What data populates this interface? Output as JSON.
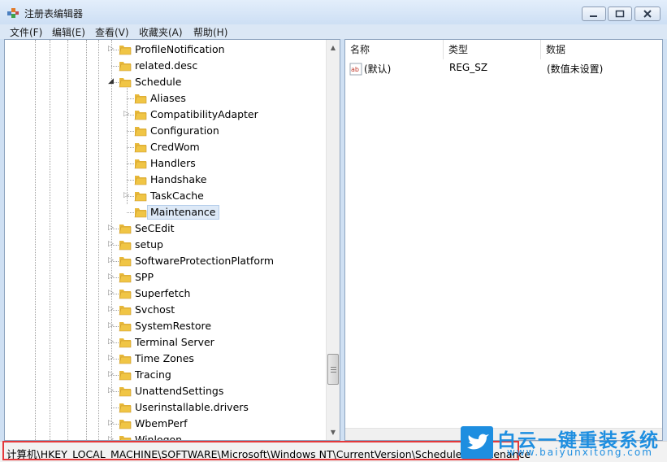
{
  "window": {
    "title": "注册表编辑器"
  },
  "menu": [
    "文件(F)",
    "编辑(E)",
    "查看(V)",
    "收藏夹(A)",
    "帮助(H)"
  ],
  "tree": {
    "nodes": [
      {
        "label": "ProfileNotification",
        "expandable": true,
        "selected": false
      },
      {
        "label": "related.desc",
        "expandable": false,
        "selected": false
      },
      {
        "label": "Schedule",
        "expandable": true,
        "expanded": true,
        "selected": false
      },
      {
        "label": "Aliases",
        "expandable": false,
        "selected": false
      },
      {
        "label": "CompatibilityAdapter",
        "expandable": true,
        "selected": false
      },
      {
        "label": "Configuration",
        "expandable": false,
        "selected": false
      },
      {
        "label": "CredWom",
        "expandable": false,
        "selected": false
      },
      {
        "label": "Handlers",
        "expandable": false,
        "selected": false
      },
      {
        "label": "Handshake",
        "expandable": false,
        "selected": false
      },
      {
        "label": "TaskCache",
        "expandable": true,
        "selected": false
      },
      {
        "label": "Maintenance",
        "expandable": false,
        "selected": true
      },
      {
        "label": "SeCEdit",
        "expandable": true,
        "selected": false
      },
      {
        "label": "setup",
        "expandable": true,
        "selected": false
      },
      {
        "label": "SoftwareProtectionPlatform",
        "expandable": true,
        "selected": false
      },
      {
        "label": "SPP",
        "expandable": true,
        "selected": false
      },
      {
        "label": "Superfetch",
        "expandable": true,
        "selected": false
      },
      {
        "label": "Svchost",
        "expandable": true,
        "selected": false
      },
      {
        "label": "SystemRestore",
        "expandable": true,
        "selected": false
      },
      {
        "label": "Terminal Server",
        "expandable": true,
        "selected": false
      },
      {
        "label": "Time Zones",
        "expandable": true,
        "selected": false
      },
      {
        "label": "Tracing",
        "expandable": true,
        "selected": false
      },
      {
        "label": "UnattendSettings",
        "expandable": true,
        "selected": false
      },
      {
        "label": "Userinstallable.drivers",
        "expandable": false,
        "selected": false
      },
      {
        "label": "WbemPerf",
        "expandable": true,
        "selected": false
      },
      {
        "label": "Winlogon",
        "expandable": true,
        "selected": false
      }
    ]
  },
  "list": {
    "columns": [
      "名称",
      "类型",
      "数据"
    ],
    "rows": [
      {
        "icon": "string-value-icon",
        "name": "(默认)",
        "type": "REG_SZ",
        "data": "(数值未设置)"
      }
    ]
  },
  "status": {
    "path": "计算机\\HKEY_LOCAL_MACHINE\\SOFTWARE\\Microsoft\\Windows NT\\CurrentVersion\\Schedule\\Maintenance"
  },
  "watermark": {
    "title": "白云一键重装系统",
    "url": "www.baiyunxitong.com"
  },
  "colors": {
    "highlight": "#e3383b",
    "watermark": "#1e8ee0",
    "folder": "#f0c545"
  }
}
